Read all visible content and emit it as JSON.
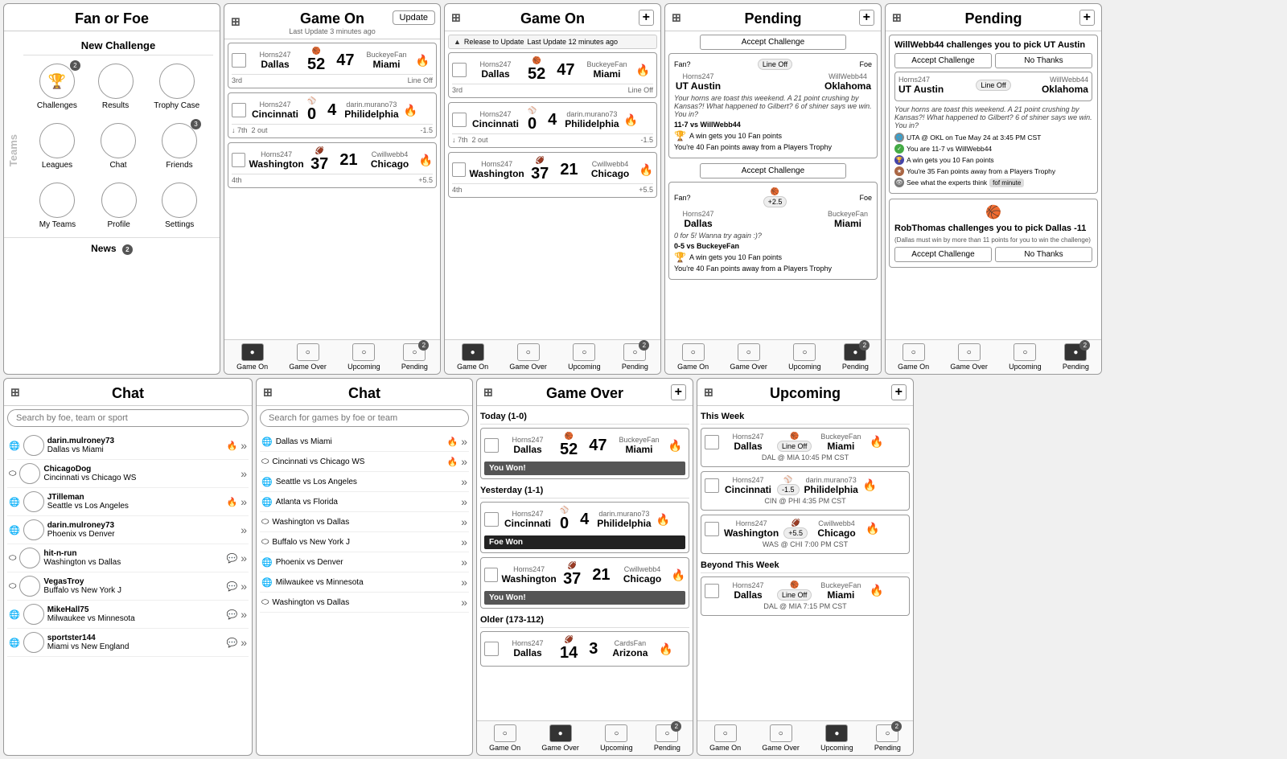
{
  "panels": {
    "fanfoe": {
      "title": "Fan or Foe",
      "new_challenge": "New Challenge",
      "teams_label": "Teams",
      "news_label": "News",
      "news_badge": "2",
      "icons": [
        {
          "label": "Challenges",
          "badge": "2"
        },
        {
          "label": "Results",
          "badge": null
        },
        {
          "label": "Trophy Case",
          "badge": null
        },
        {
          "label": "Leagues",
          "badge": null
        },
        {
          "label": "Chat",
          "badge": null
        },
        {
          "label": "Friends",
          "badge": "3"
        },
        {
          "label": "My Teams",
          "badge": null
        },
        {
          "label": "Profile",
          "badge": null
        },
        {
          "label": "Settings",
          "badge": null
        }
      ]
    },
    "gameon1": {
      "title": "Game On",
      "sub": "Last Update 3 minutes ago",
      "update_btn": "Update",
      "games": [
        {
          "fan": "Horns247",
          "fan_city": "Dallas",
          "fan_score": "52",
          "foe": "BuckeyeFan",
          "foe_city": "Miami",
          "foe_score": "47",
          "period": "3rd",
          "line": "Line Off",
          "spread": null
        },
        {
          "fan": "Horns247",
          "fan_city": "Cincinnati",
          "fan_score": "0",
          "foe": "darin.murano73",
          "foe_city": "Philidelphia",
          "foe_score": "4",
          "period": "7th",
          "line": "2 out",
          "spread": "-1.5"
        },
        {
          "fan": "Horns247",
          "fan_city": "Washington",
          "fan_score": "37",
          "foe": "Cwillwebb4",
          "foe_city": "Chicago",
          "foe_score": "21",
          "period": "4th",
          "line": null,
          "spread": "+5.5"
        }
      ],
      "footer": [
        "Game On",
        "Game Over",
        "Upcoming",
        "Pending"
      ],
      "footer_badge": {
        "pending": "2"
      }
    },
    "gameon2": {
      "title": "Game On",
      "release_text": "Release to Update",
      "last_update": "Last Update 12 minutes ago",
      "games": [
        {
          "fan": "Horns247",
          "fan_city": "Dallas",
          "fan_score": "52",
          "foe": "BuckeyeFan",
          "foe_city": "Miami",
          "foe_score": "47",
          "period": "3rd",
          "line": "Line Off",
          "spread": null
        },
        {
          "fan": "Horns247",
          "fan_city": "Cincinnati",
          "fan_score": "0",
          "foe": "darin.murano73",
          "foe_city": "Philidelphia",
          "foe_score": "4",
          "period": "7th",
          "line": "2 out",
          "spread": "-1.5"
        },
        {
          "fan": "Horns247",
          "fan_city": "Washington",
          "fan_score": "37",
          "foe": "Cwillwebb4",
          "foe_city": "Chicago",
          "foe_score": "21",
          "period": "4th",
          "line": null,
          "spread": "+5.5"
        }
      ],
      "footer": [
        "Game On",
        "Game Over",
        "Upcoming",
        "Pending"
      ],
      "footer_badge": {
        "pending": "2"
      }
    },
    "pending1": {
      "title": "Pending",
      "accept_challenge_label": "Accept Challenge",
      "challenges": [
        {
          "fan_label": "Fan?",
          "fan_user": "Horns247",
          "fan_city": "UT Austin",
          "foe_label": "Foe",
          "foe_user": "WillWebb44",
          "foe_city": "Oklahoma",
          "line": "Line Off",
          "msg": "Your horns are toast this weekend. A 21 point crushing by Kansas?! What happened to Gilbert? 6 of shiner says we win. You in?",
          "record": "11-7 vs WillWebb44",
          "points1": "A win gets you 10 Fan points",
          "points2": "You're 40 Fan points away from a Players Trophy",
          "accept": "Accept Challenge",
          "decline": null
        },
        {
          "fan_label": "Fan?",
          "fan_user": "Horns247",
          "fan_city": "Dallas",
          "foe_label": "Foe",
          "foe_user": "BuckeyeFan",
          "foe_city": "Miami",
          "spread": "+2.5",
          "msg": "0 for 5! Wanna try again :)?",
          "record": "0-5 vs BuckeyeFan",
          "points1": "A win gets you 10 Fan points",
          "points2": "You're 40 Fan points away from a Players Trophy",
          "accept": "Accept Challenge",
          "decline": null
        }
      ],
      "footer": [
        "Game On",
        "Game Over",
        "Upcoming",
        "Pending"
      ],
      "footer_badge": {
        "pending": "2"
      }
    },
    "pending2": {
      "title": "Pending",
      "challenges": [
        {
          "intro": "WillWebb44 challenges you to pick UT Austin",
          "fan_user": "Horns247",
          "fan_city": "UT Austin",
          "foe_user": "WillWebb44",
          "foe_city": "Oklahoma",
          "line": "Line Off",
          "msg": "Your horns are toast this weekend. A 21 point crushing by Kansas?! What happened to Gilbert? 6 of shiner says we win. You in?",
          "accept": "Accept Challenge",
          "decline": "No Thanks",
          "info": [
            {
              "icon": "globe",
              "text": "UTA @ OKL on Tue May 24 at 3:45 PM CST"
            },
            {
              "icon": "check",
              "text": "You are 11-7 vs WillWebb44"
            },
            {
              "icon": "trophy",
              "text": "A win gets you 10 Fan points"
            },
            {
              "icon": "star",
              "text": "You're 35 Fan points away from a Players Trophy"
            },
            {
              "icon": "eye",
              "text": "See what the experts think",
              "tag": "fof minute"
            }
          ]
        },
        {
          "intro": "RobThomas challenges you to pick Dallas -11",
          "sub_intro": "(Dallas must win by more than 11 points for you to win the challenge)",
          "accept": "Accept Challenge",
          "decline": "No Thanks"
        }
      ],
      "footer": [
        "Game On",
        "Game Over",
        "Upcoming",
        "Pending"
      ],
      "footer_badge": {
        "pending": "2"
      }
    },
    "chat1": {
      "title": "Chat",
      "search_placeholder": "Search by foe, team or sport",
      "items": [
        {
          "sport": "globe",
          "user": "darin.mulroney73",
          "game": "Dallas vs Miami",
          "has_fire": true
        },
        {
          "sport": "oval",
          "user": "ChicagoDog",
          "game": "Cincinnati vs Chicago WS",
          "has_fire": false
        },
        {
          "sport": "globe",
          "user": "JTilleman",
          "game": "Seattle vs Los Angeles",
          "has_fire": true
        },
        {
          "sport": "globe",
          "user": "darin.mulroney73",
          "game": "Phoenix vs Denver",
          "has_fire": false
        },
        {
          "sport": "oval",
          "user": "hit-n-run",
          "game": "Washington vs Dallas",
          "has_fire": false
        },
        {
          "sport": "oval",
          "user": "VegasTroy",
          "game": "Buffalo vs New York J",
          "has_fire": false
        },
        {
          "sport": "globe",
          "user": "MikeHall75",
          "game": "Milwaukee vs Minnesota",
          "has_fire": false
        },
        {
          "sport": "globe",
          "user": "sportster144",
          "game": "Miami vs New England",
          "has_fire": false
        }
      ]
    },
    "chat2": {
      "title": "Chat",
      "search_placeholder": "Search for games by foe or team",
      "items": [
        {
          "sport": "globe",
          "game": "Dallas vs Miami",
          "has_fire": true
        },
        {
          "sport": "oval",
          "game": "Cincinnati vs Chicago WS",
          "has_fire": true
        },
        {
          "sport": "globe",
          "game": "Seattle vs Los Angeles",
          "has_fire": false
        },
        {
          "sport": "globe",
          "game": "Atlanta vs Florida",
          "has_fire": false
        },
        {
          "sport": "oval",
          "game": "Washington vs Dallas",
          "has_fire": false
        },
        {
          "sport": "oval",
          "game": "Buffalo vs New York J",
          "has_fire": false
        },
        {
          "sport": "globe",
          "game": "Phoenix vs Denver",
          "has_fire": false
        },
        {
          "sport": "globe",
          "game": "Milwaukee vs Minnesota",
          "has_fire": false
        },
        {
          "sport": "oval",
          "game": "Washington vs Dallas",
          "has_fire": false
        }
      ]
    },
    "gameover": {
      "title": "Game Over",
      "sections": [
        {
          "label": "Today (1-0)",
          "games": [
            {
              "fan": "Horns247",
              "fan_city": "Dallas",
              "fan_score": "52",
              "foe": "BuckeyeFan",
              "foe_city": "Miami",
              "foe_score": "47",
              "result": "You Won!",
              "won": true
            }
          ]
        },
        {
          "label": "Yesterday (1-1)",
          "games": [
            {
              "fan": "Horns247",
              "fan_city": "Cincinnati",
              "fan_score": "0",
              "foe": "darin.murano73",
              "foe_city": "Philidelphia",
              "foe_score": "4",
              "result": "Foe Won",
              "won": false
            },
            {
              "fan": "Horns247",
              "fan_city": "Washington",
              "fan_score": "37",
              "foe": "Cwillwebb4",
              "foe_city": "Chicago",
              "foe_score": "21",
              "result": "You Won!",
              "won": true
            }
          ]
        },
        {
          "label": "Older (173-112)",
          "games": [
            {
              "fan": "Horns247",
              "fan_city": "Dallas",
              "fan_score": "14",
              "foe": "CardsFan",
              "foe_city": "Arizona",
              "foe_score": "3",
              "result": null,
              "won": true
            }
          ]
        }
      ],
      "footer": [
        "Game On",
        "Game Over",
        "Upcoming",
        "Pending"
      ],
      "footer_badge": {
        "pending": "2"
      }
    },
    "upcoming": {
      "title": "Upcoming",
      "sections": [
        {
          "label": "This Week",
          "games": [
            {
              "fan": "Horns247",
              "fan_city": "Dallas",
              "foe": "BuckeyeFan",
              "foe_city": "Miami",
              "line": "Line Off",
              "time": "DAL @ MIA 10:45 PM CST"
            },
            {
              "fan": "Horns247",
              "fan_city": "Cincinnati",
              "spread": "-1.5",
              "foe": "darin.murano73",
              "foe_city": "Philidelphia",
              "line": null,
              "time": "CIN @ PHI 4:35 PM CST"
            },
            {
              "fan": "Horns247",
              "fan_city": "Washington",
              "spread": "+5.5",
              "foe": "Cwillwebb4",
              "foe_city": "Chicago",
              "line": null,
              "time": "WAS @ CHI 7:00 PM CST"
            }
          ]
        },
        {
          "label": "Beyond This Week",
          "games": [
            {
              "fan": "Horns247",
              "fan_city": "Dallas",
              "foe": "BuckeyeFan",
              "foe_city": "Miami",
              "line": "Line Off",
              "time": "DAL @ MIA 7:15 PM CST"
            }
          ]
        }
      ],
      "footer": [
        "Game On",
        "Game Over",
        "Upcoming",
        "Pending"
      ],
      "footer_badge": {
        "pending": "2"
      }
    }
  },
  "footer_labels": {
    "game_on": "Game On",
    "game_over": "Game Over",
    "upcoming": "Upcoming",
    "pending": "Pending"
  }
}
